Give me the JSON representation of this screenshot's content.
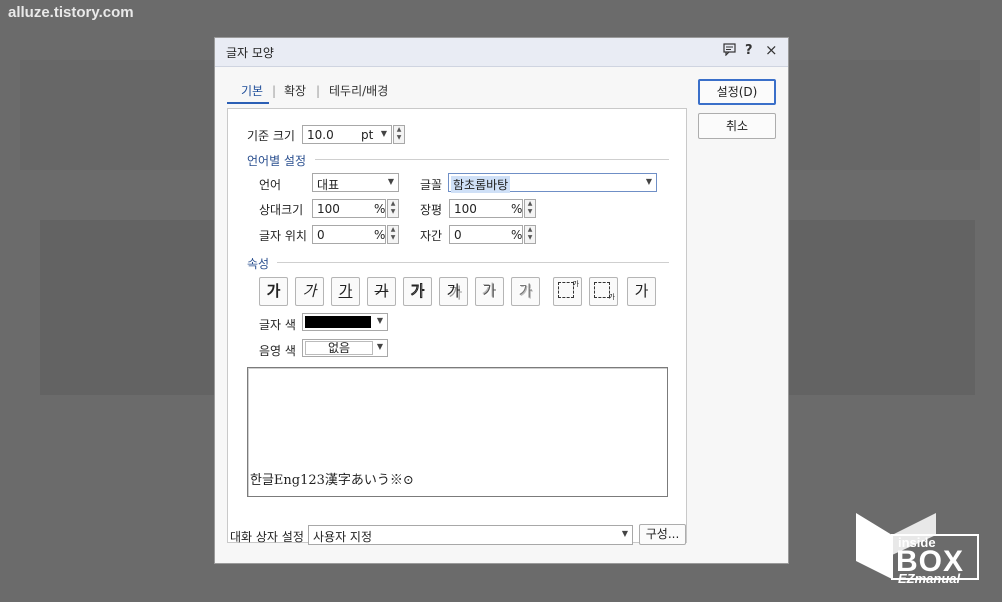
{
  "watermark": {
    "url": "alluze.tistory.com"
  },
  "logo": {
    "line1": "inside",
    "line2": "BOX",
    "line3": "EZmanual"
  },
  "dialog": {
    "title": "글자 모양",
    "titlebar_icons": [
      "message-icon",
      "help-icon",
      "close-icon"
    ],
    "help_glyph": "?",
    "close_glyph": "×",
    "tabs": [
      {
        "label": "기본",
        "active": true
      },
      {
        "label": "확장",
        "active": false
      },
      {
        "label": "테두리/배경",
        "active": false
      }
    ],
    "tab_separator": "|",
    "buttons": {
      "ok": "설정(D)",
      "cancel": "취소"
    },
    "base_size": {
      "label": "기준 크기",
      "value": "10.0",
      "unit": "pt"
    },
    "language_section": {
      "title": "언어별 설정",
      "language_label": "언어",
      "language_value": "대표",
      "font_label": "글꼴",
      "font_value": "함초롬바탕",
      "relative_size_label": "상대크기",
      "relative_size_value": "100",
      "width_label": "장평",
      "width_value": "100",
      "position_label": "글자 위치",
      "position_value": "0",
      "spacing_label": "자간",
      "spacing_value": "0",
      "percent_unit": "%"
    },
    "attributes_section": {
      "title": "속성",
      "buttons": [
        {
          "name": "bold-button",
          "glyph": "가"
        },
        {
          "name": "italic-button",
          "glyph": "가"
        },
        {
          "name": "underline-button",
          "glyph": "가"
        },
        {
          "name": "strikethrough-button",
          "glyph": "가"
        },
        {
          "name": "outline-button",
          "glyph": "가"
        },
        {
          "name": "shadow-button",
          "glyph": "가"
        },
        {
          "name": "emboss-button",
          "glyph": "가"
        },
        {
          "name": "engrave-button",
          "glyph": "가"
        },
        {
          "name": "superscript-button",
          "glyph": "가"
        },
        {
          "name": "subscript-button",
          "glyph": "가"
        },
        {
          "name": "normal-button",
          "glyph": "가"
        }
      ],
      "text_color_label": "글자 색",
      "text_color": "#000000",
      "shade_color_label": "음영 색",
      "shade_color_value": "없음"
    },
    "preview_text": "한글Eng123漢字あいう※⊙",
    "bottom": {
      "label": "대화 상자 설정",
      "value": "사용자 지정",
      "configure_button": "구성..."
    },
    "accent_color": "#2b5fb5"
  }
}
